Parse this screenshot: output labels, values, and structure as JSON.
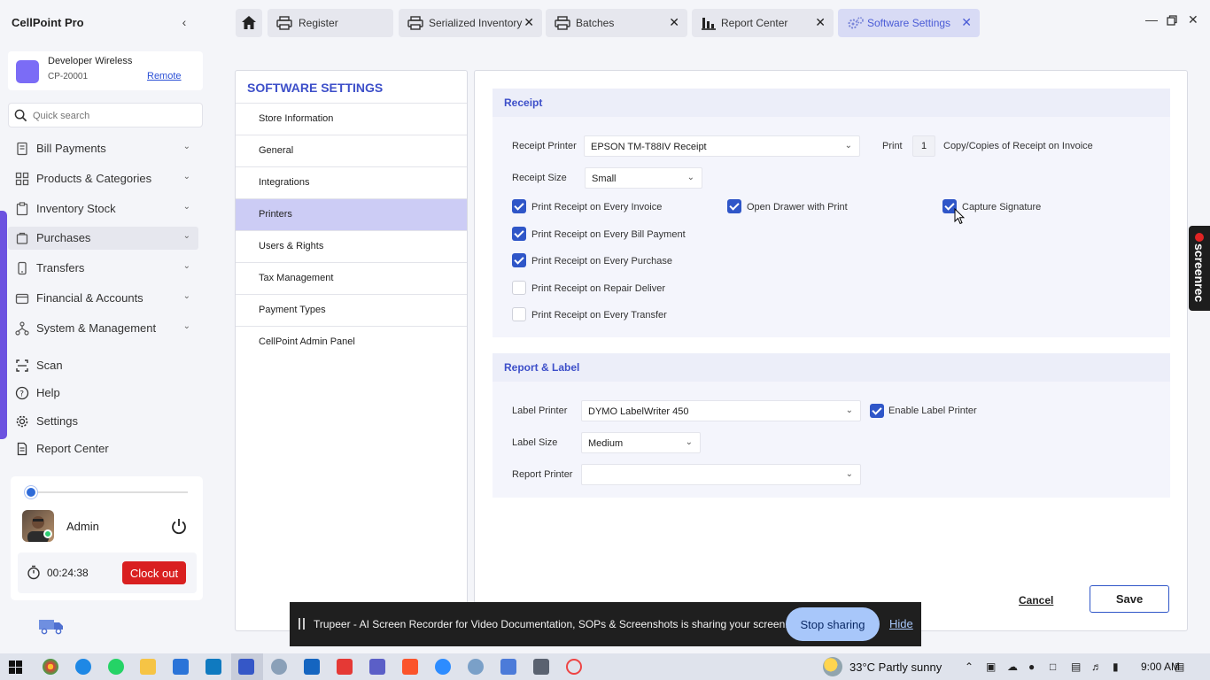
{
  "app": {
    "title": "CellPoint Pro",
    "collapse": "‹"
  },
  "store": {
    "name": "Developer Wireless",
    "code": "CP-20001",
    "remote_label": "Remote"
  },
  "search": {
    "placeholder": "Quick search"
  },
  "nav": [
    {
      "label": "Bill Payments",
      "icon": "receipt-icon"
    },
    {
      "label": "Products & Categories",
      "icon": "grid-icon"
    },
    {
      "label": "Inventory Stock",
      "icon": "clipboard-icon"
    },
    {
      "label": "Purchases",
      "icon": "cart-icon"
    },
    {
      "label": "Transfers",
      "icon": "transfer-icon"
    },
    {
      "label": "Financial & Accounts",
      "icon": "wallet-icon"
    },
    {
      "label": "System & Management",
      "icon": "nodes-icon"
    }
  ],
  "nav_bottom": [
    {
      "label": "Scan",
      "icon": "scan-icon"
    },
    {
      "label": "Help",
      "icon": "help-icon"
    },
    {
      "label": "Settings",
      "icon": "gear-icon"
    },
    {
      "label": "Report Center",
      "icon": "document-icon"
    }
  ],
  "user": {
    "name": "Admin",
    "timer": "00:24:38",
    "clockout_label": "Clock out"
  },
  "tabs": [
    {
      "label": "Register",
      "icon": "printer-icon"
    },
    {
      "label": "Serialized Inventory",
      "icon": "printer-icon"
    },
    {
      "label": "Batches",
      "icon": "printer-icon"
    },
    {
      "label": "Report Center",
      "icon": "bar-chart-icon"
    },
    {
      "label": "Software Settings",
      "icon": "gears-icon",
      "active": true
    }
  ],
  "settings_menu": {
    "title": "SOFTWARE SETTINGS",
    "items": [
      "Store Information",
      "General",
      "Integrations",
      "Printers",
      "Users & Rights",
      "Tax Management",
      "Payment Types",
      "CellPoint Admin Panel"
    ],
    "active": "Printers"
  },
  "receipt": {
    "title": "Receipt",
    "printer_label": "Receipt Printer",
    "printer_value": "EPSON TM-T88IV Receipt",
    "print_label": "Print",
    "copies": "1",
    "copies_suffix": "Copy/Copies of Receipt on Invoice",
    "size_label": "Receipt Size",
    "size_value": "Small",
    "options": [
      {
        "label": "Print Receipt on Every Invoice",
        "checked": true
      },
      {
        "label": "Open Drawer with Print",
        "checked": true
      },
      {
        "label": "Capture Signature",
        "checked": true
      },
      {
        "label": "Print Receipt on Every Bill Payment",
        "checked": true
      },
      {
        "label": "Print Receipt on Every Purchase",
        "checked": true
      },
      {
        "label": "Print Receipt on Repair Deliver",
        "checked": false
      },
      {
        "label": "Print Receipt on Every Transfer",
        "checked": false
      }
    ]
  },
  "report_label": {
    "title": "Report & Label",
    "label_printer_label": "Label Printer",
    "label_printer_value": "DYMO LabelWriter 450",
    "enable_label": "Enable Label Printer",
    "enable_checked": true,
    "label_size_label": "Label Size",
    "label_size_value": "Medium",
    "report_printer_label": "Report Printer",
    "report_printer_value": ""
  },
  "actions": {
    "cancel": "Cancel",
    "save": "Save"
  },
  "share_banner": {
    "text": "Trupeer - AI Screen Recorder for Video Documentation, SOPs & Screenshots is sharing your screen.",
    "stop": "Stop sharing",
    "hide": "Hide"
  },
  "screenrec": {
    "label": "screenrec"
  },
  "taskbar": {
    "weather": "33°C  Partly sunny",
    "time": "9:00 AM"
  },
  "colors": {
    "accent": "#3d4fc9",
    "checkbox": "#2f56c8",
    "clockout": "#d92020",
    "active_menu": "#ccccf5"
  }
}
